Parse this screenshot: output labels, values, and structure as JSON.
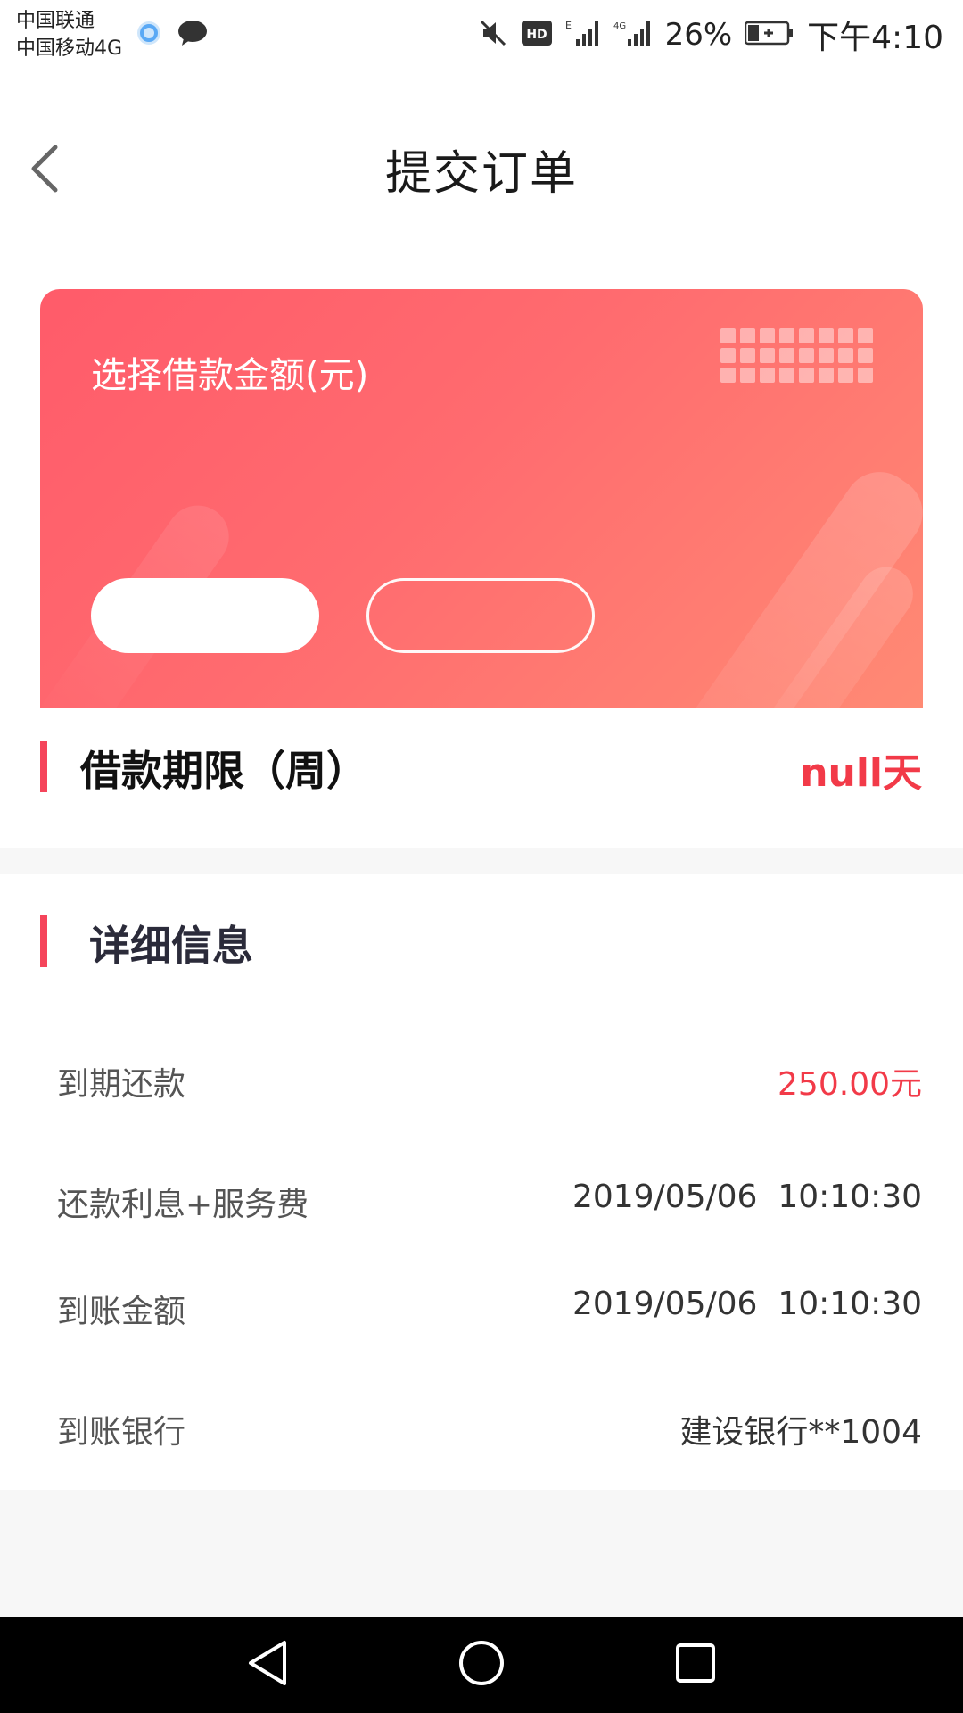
{
  "status_bar": {
    "carrier_1": "中国联通",
    "carrier_2": "中国移动4G",
    "battery_percent": "26%",
    "time": "下午4:10",
    "icons": [
      "cloud-icon",
      "chat-icon",
      "mute-icon",
      "hd-icon",
      "signal-e-icon",
      "signal-4g-icon",
      "battery-charging-icon"
    ]
  },
  "header": {
    "title": "提交订单",
    "back_icon": "chevron-left-icon"
  },
  "loan_card": {
    "label": "选择借款金额(元)",
    "options": [
      "",
      ""
    ],
    "selected_index": 0,
    "colors": {
      "gradient_start": "#ff5b6a",
      "gradient_end": "#ff8a74"
    }
  },
  "term": {
    "label": "借款期限（周）",
    "value": "null天"
  },
  "details": {
    "title": "详细信息",
    "rows": [
      {
        "label": "到期还款",
        "value": "250.00元"
      },
      {
        "label": "还款利息+服务费",
        "value": "2019/05/06  10:10:30"
      },
      {
        "label": "到账金额",
        "value": "2019/05/06  10:10:30"
      },
      {
        "label": "到账银行",
        "value": "建设银行**1004"
      }
    ]
  },
  "nav_bar": {
    "icons": [
      "nav-back-icon",
      "nav-home-icon",
      "nav-recents-icon"
    ]
  },
  "colors": {
    "accent": "#f5455b",
    "value_red": "#f23a48",
    "background": "#f7f7f7"
  }
}
